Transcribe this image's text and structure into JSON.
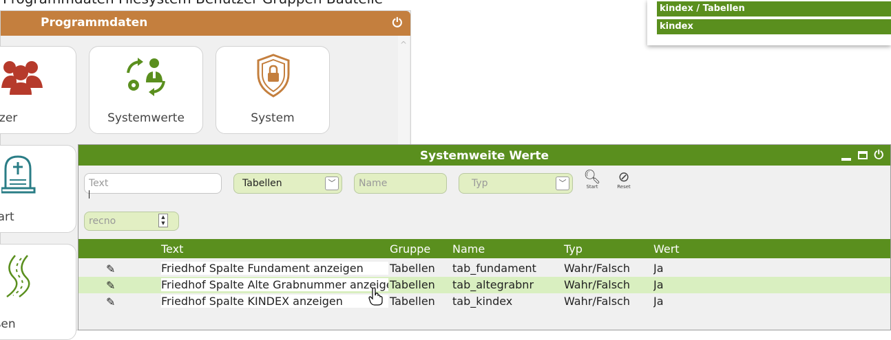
{
  "top_cut_text": "Programmdaten Filesystem Benutzer Gruppen Bauteile",
  "top_right_popup": {
    "rows": [
      "kindex / Tabellen",
      "kindex"
    ]
  },
  "programmdaten": {
    "title": "Programmdaten",
    "tiles": [
      {
        "label": "nutzer",
        "icon": "users-icon"
      },
      {
        "label": "Systemwerte",
        "icon": "system-values-icon"
      },
      {
        "label": "System",
        "icon": "shield-lock-icon"
      },
      {
        "label": "abart",
        "icon": "grave-icon"
      },
      {
        "label": "raßen",
        "icon": "road-icon"
      }
    ],
    "colors": {
      "header": "#c47f3e"
    }
  },
  "systemweite_werte": {
    "title": "Systemweite Werte",
    "filters": {
      "text_placeholder": "Text",
      "group_value": "Tabellen",
      "name_placeholder": "Name",
      "type_placeholder": "Typ",
      "recno_placeholder": "recno"
    },
    "buttons": {
      "start": "Start",
      "reset": "Reset"
    },
    "columns": [
      "Text",
      "Gruppe",
      "Name",
      "Typ",
      "Wert"
    ],
    "rows": [
      {
        "text": "Friedhof Spalte Fundament anzeigen",
        "gruppe": "Tabellen",
        "name": "tab_fundament",
        "typ": "Wahr/Falsch",
        "wert": "Ja"
      },
      {
        "text": "Friedhof Spalte Alte Grabnummer anzeigen",
        "gruppe": "Tabellen",
        "name": "tab_altegrabnr",
        "typ": "Wahr/Falsch",
        "wert": "Ja"
      },
      {
        "text": "Friedhof Spalte KINDEX anzeigen",
        "gruppe": "Tabellen",
        "name": "tab_kindex",
        "typ": "Wahr/Falsch",
        "wert": "Ja"
      }
    ],
    "colors": {
      "header": "#5a8f1e",
      "row_highlight": "#d9efc0"
    }
  }
}
